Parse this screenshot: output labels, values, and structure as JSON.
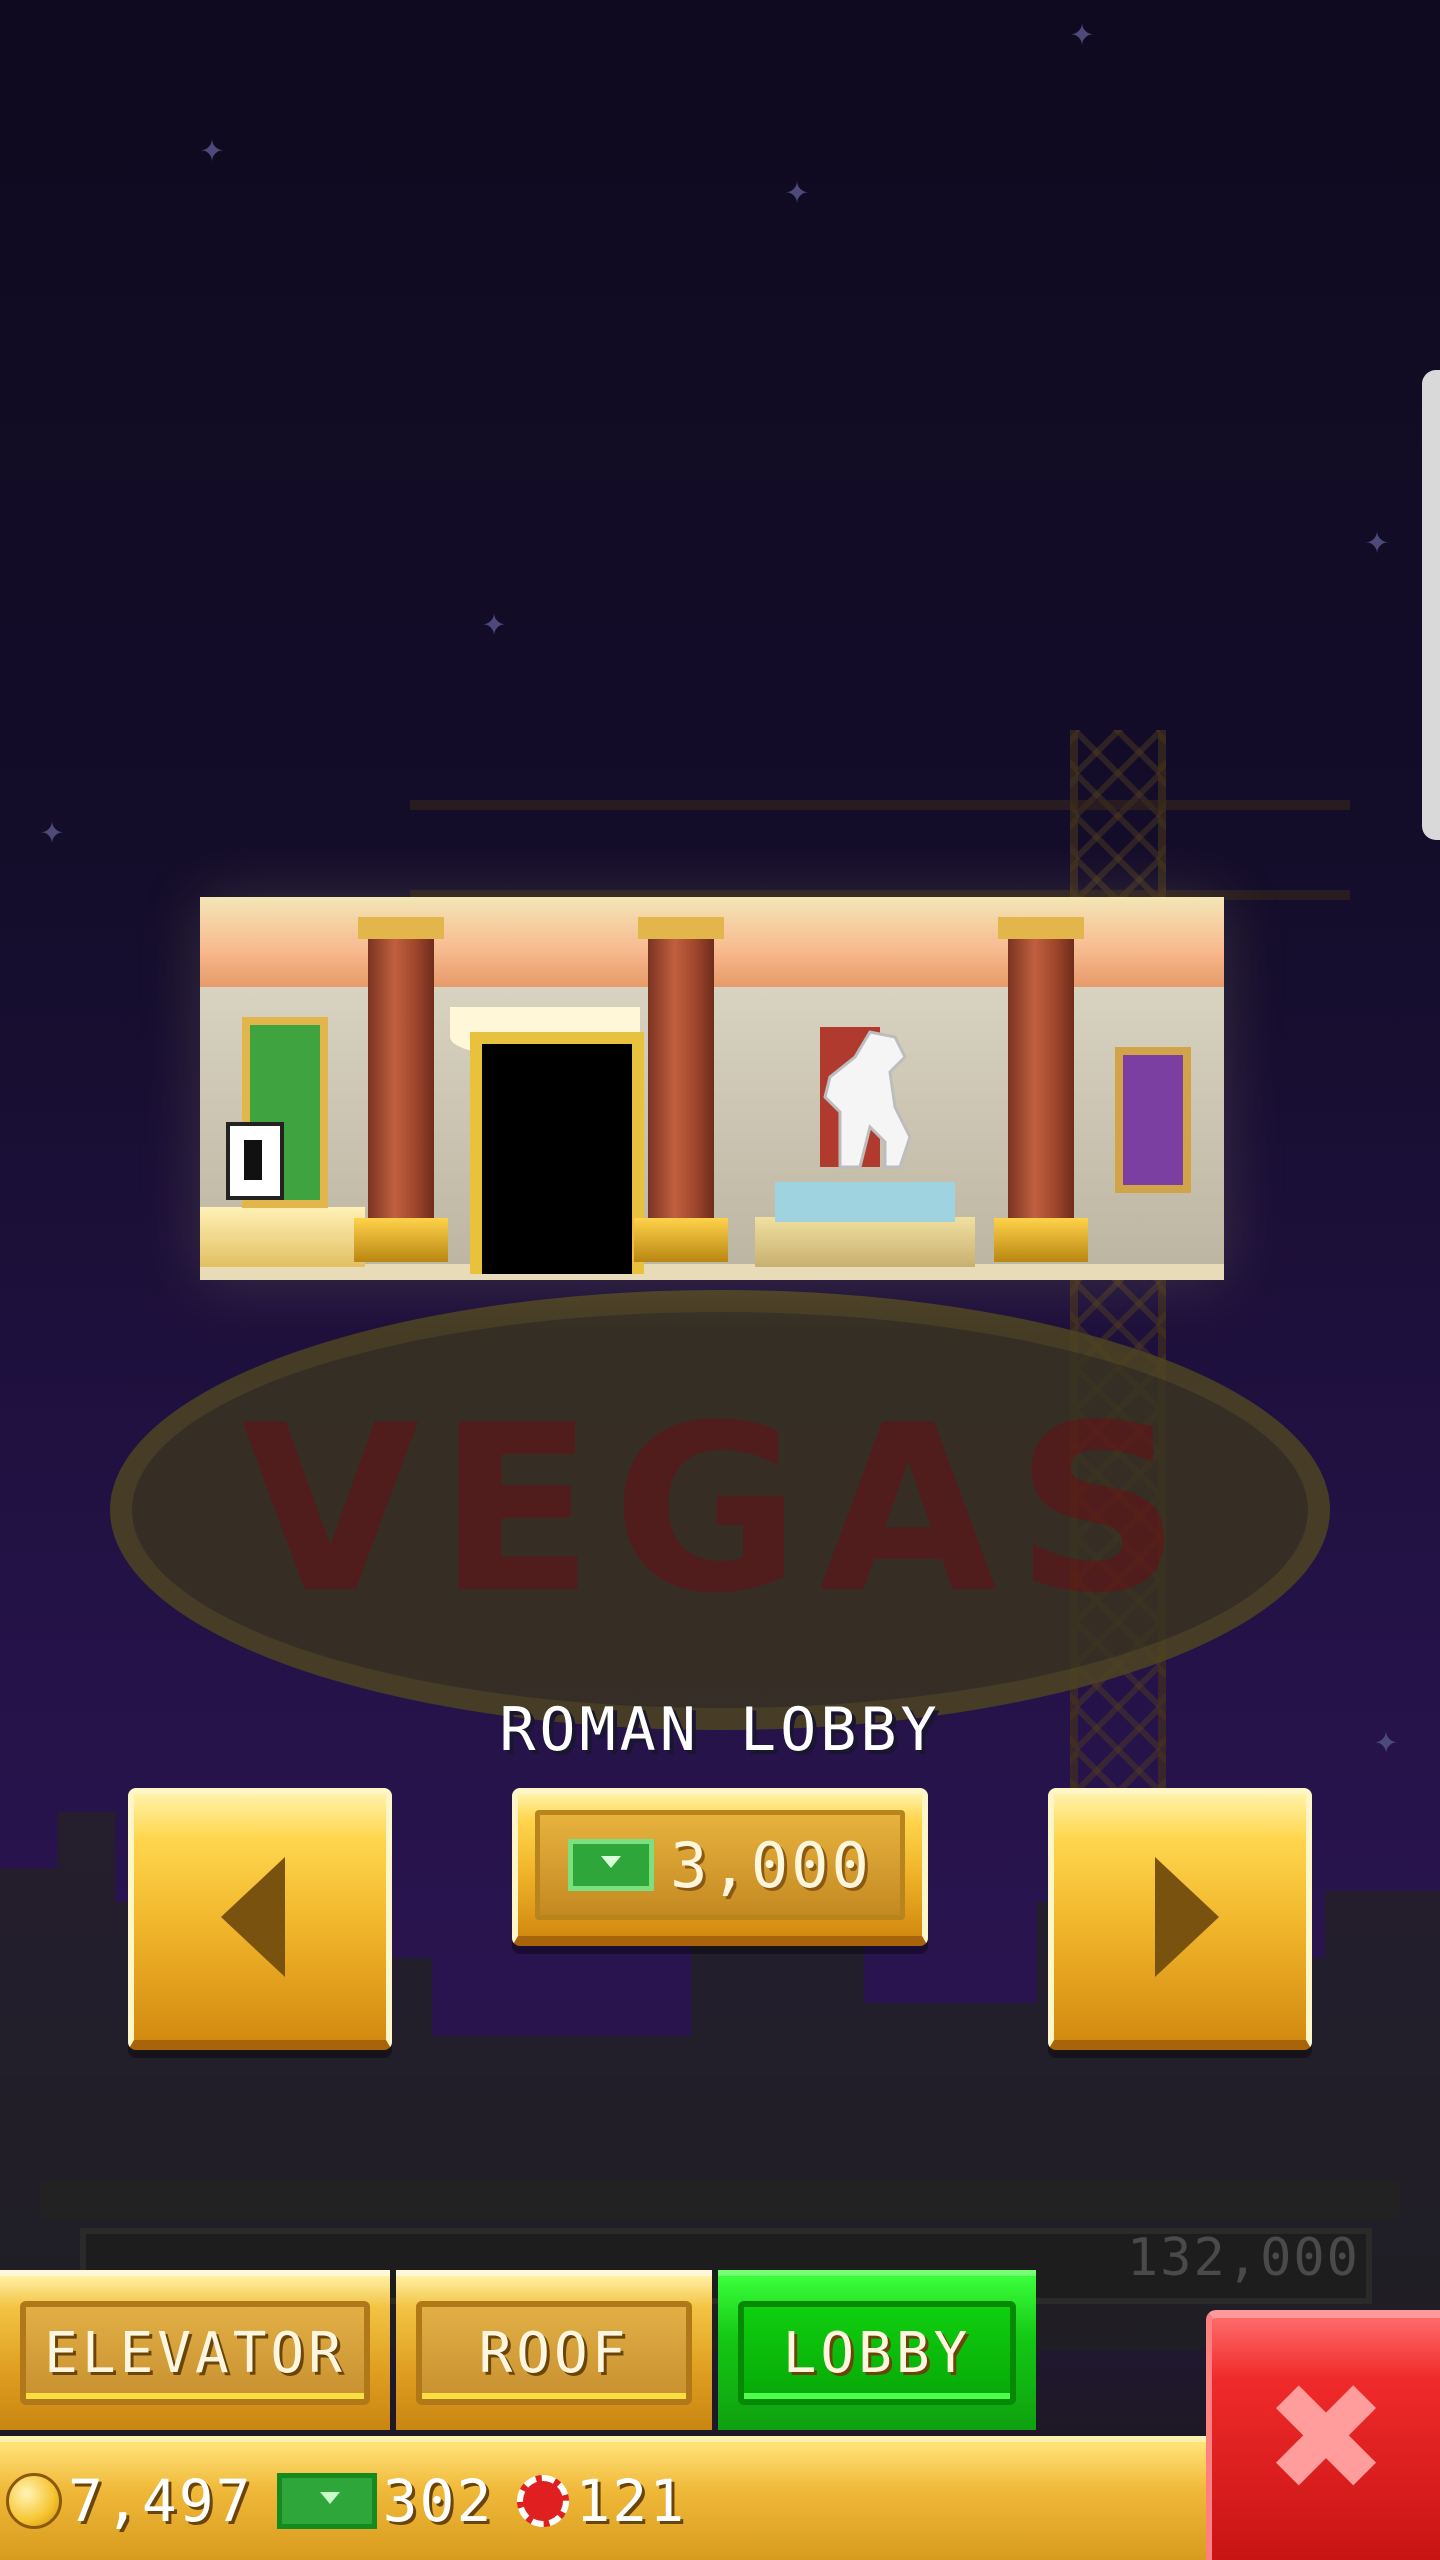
{
  "background": {
    "sign_text": "VEGAS",
    "floor_price": "132,000"
  },
  "room": {
    "name": "ROMAN LOBBY",
    "price": "3,000",
    "price_currency_icon": "tower-bux-icon"
  },
  "tabs": [
    {
      "label": "ELEVATOR",
      "active": false
    },
    {
      "label": "ROOF",
      "active": false
    },
    {
      "label": "LOBBY",
      "active": true
    }
  ],
  "currency": {
    "coins": "7,497",
    "bux": "302",
    "chips": "121"
  },
  "icons": {
    "prev": "arrow-left-icon",
    "next": "arrow-right-icon",
    "close": "close-x-icon"
  },
  "colors": {
    "gold": "#f0b42a",
    "active_tab": "#14c814",
    "close": "#f02a2a"
  }
}
